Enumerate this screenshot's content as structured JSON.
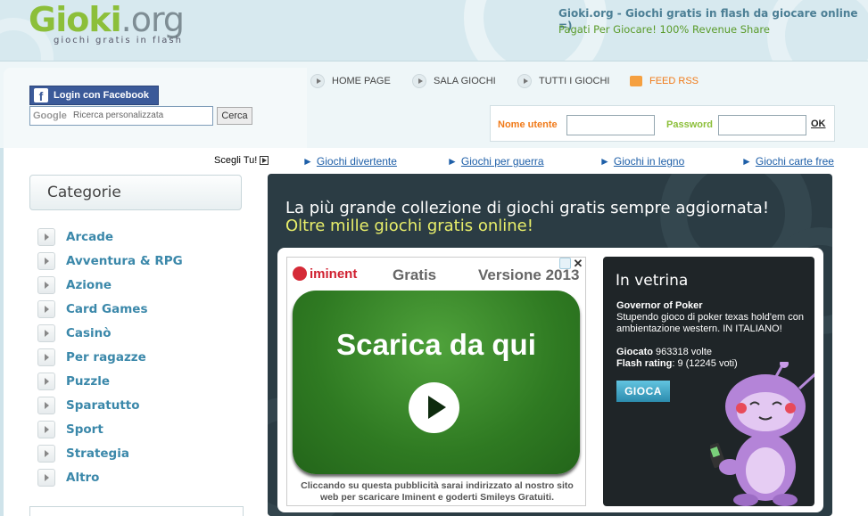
{
  "site": {
    "logo_main": "Gioki",
    "logo_ext": ".org",
    "logo_tagline": "giochi gratis in flash",
    "header_title": "Gioki.org - Giochi gratis in flash da giocare online =)",
    "header_subtitle": "Pagati Per Giocare! 100% Revenue Share"
  },
  "account": {
    "facebook_label": "Login con Facebook",
    "search_placeholder": "Ricerca personalizzata",
    "search_brand": "Google",
    "search_button": "Cerca",
    "username_label": "Nome utente",
    "password_label": "Password",
    "ok_label": "OK",
    "username_value": "",
    "password_value": ""
  },
  "topnav": [
    {
      "label": "HOME PAGE"
    },
    {
      "label": "SALA GIOCHI"
    },
    {
      "label": "TUTTI I GIOCHI"
    },
    {
      "label": "FEED RSS"
    }
  ],
  "quicklinks": {
    "prompt": "Scegli Tu!",
    "links": [
      {
        "label": "Giochi divertente"
      },
      {
        "label": "Giochi per guerra"
      },
      {
        "label": "Giochi in legno"
      },
      {
        "label": "Giochi carte free"
      }
    ]
  },
  "categories": {
    "title": "Categorie",
    "items": [
      {
        "label": "Arcade"
      },
      {
        "label": "Avventura & RPG"
      },
      {
        "label": "Azione"
      },
      {
        "label": "Card Games"
      },
      {
        "label": "Casinò"
      },
      {
        "label": "Per ragazze"
      },
      {
        "label": "Puzzle"
      },
      {
        "label": "Sparatutto"
      },
      {
        "label": "Sport"
      },
      {
        "label": "Strategia"
      },
      {
        "label": "Altro"
      }
    ]
  },
  "hero": {
    "title": "La più grande collezione di giochi gratis sempre aggiornata!",
    "subtitle": "Oltre mille giochi gratis online!"
  },
  "ad": {
    "brand": "iminent",
    "gratis": "Gratis",
    "version": "Versione 2013",
    "cta": "Scarica da qui",
    "footer": "Cliccando su questa pubblicità sarai indirizzato al nostro sito web per scaricare Iminent e goderti Smileys Gratuiti."
  },
  "vetrina": {
    "title": "In vetrina",
    "game_name": "Governor of Poker",
    "description": "Stupendo gioco di poker texas hold'em con ambientazione western. IN ITALIANO!",
    "played_label": "Giocato",
    "played_value": "963318 volte",
    "rating_label": "Flash rating",
    "rating_value": ": 9 (12245 voti)",
    "play_button": "GIOCA"
  },
  "colors": {
    "brand_green": "#8cbf3a",
    "link_blue": "#1e5fa8",
    "category_blue": "#3b88aa",
    "facebook_blue": "#3b5a99",
    "rss_orange": "#f07a19",
    "dark_panel": "#2b3c44"
  },
  "icons": [
    "facebook-icon",
    "google-icon",
    "chevron-right-icon",
    "rss-icon",
    "close-icon",
    "adchoices-icon",
    "play-icon"
  ]
}
